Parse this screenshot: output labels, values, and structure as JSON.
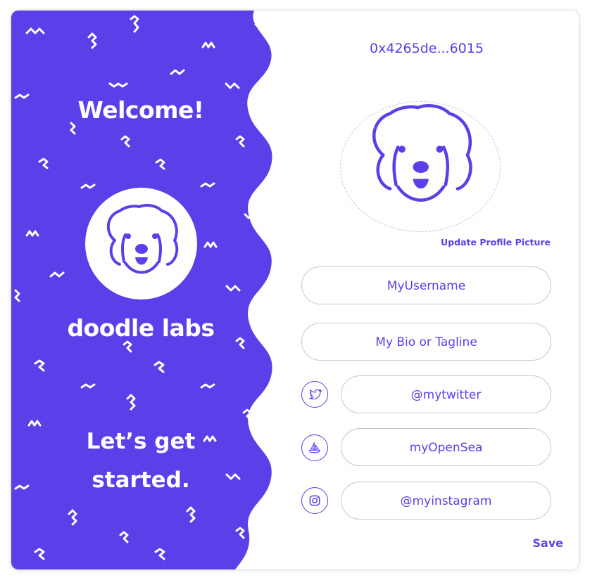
{
  "brand": {
    "welcome": "Welcome!",
    "name": "doodle labs",
    "tagline_line1": "Let’s get",
    "tagline_line2": "started.",
    "logo_icon": "dog-face-icon",
    "panel_color": "#5b3fe8"
  },
  "profile": {
    "wallet_address": "0x4265de...6015",
    "avatar_icon": "dog-face-icon",
    "update_picture_label": "Update Profile Picture",
    "username_placeholder": "MyUsername",
    "bio_placeholder": "My Bio or Tagline",
    "socials": [
      {
        "icon": "twitter-icon",
        "placeholder": "@mytwitter"
      },
      {
        "icon": "opensea-icon",
        "placeholder": "myOpenSea"
      },
      {
        "icon": "instagram-icon",
        "placeholder": "@myinstagram"
      }
    ],
    "save_label": "Save"
  },
  "colors": {
    "accent": "#5b3fe8",
    "border": "#c8c8c8",
    "background": "#ffffff"
  }
}
